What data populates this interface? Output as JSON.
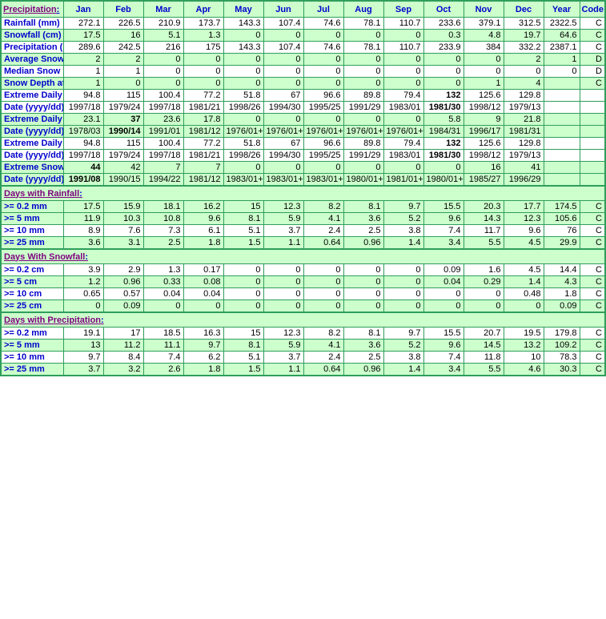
{
  "table": {
    "title": "Precipitation",
    "title_colon": ":",
    "columns": [
      "Jan",
      "Feb",
      "Mar",
      "Apr",
      "May",
      "Jun",
      "Jul",
      "Aug",
      "Sep",
      "Oct",
      "Nov",
      "Dec",
      "Year",
      "Code"
    ],
    "sections": [
      {
        "banner": null,
        "rows": [
          {
            "label": "Rainfall (mm)",
            "shade": false,
            "values": [
              "272.1",
              "226.5",
              "210.9",
              "173.7",
              "143.3",
              "107.4",
              "74.6",
              "78.1",
              "110.7",
              "233.6",
              "379.1",
              "312.5",
              "2322.5",
              "C"
            ],
            "bold": []
          },
          {
            "label": "Snowfall (cm)",
            "shade": true,
            "values": [
              "17.5",
              "16",
              "5.1",
              "1.3",
              "0",
              "0",
              "0",
              "0",
              "0",
              "0.3",
              "4.8",
              "19.7",
              "64.6",
              "C"
            ],
            "bold": []
          },
          {
            "label": "Precipitation (mm)",
            "shade": false,
            "values": [
              "289.6",
              "242.5",
              "216",
              "175",
              "143.3",
              "107.4",
              "74.6",
              "78.1",
              "110.7",
              "233.9",
              "384",
              "332.2",
              "2387.1",
              "C"
            ],
            "bold": []
          },
          {
            "label": "Average Snow Depth (cm)",
            "shade": true,
            "values": [
              "2",
              "2",
              "0",
              "0",
              "0",
              "0",
              "0",
              "0",
              "0",
              "0",
              "0",
              "2",
              "1",
              "D"
            ],
            "bold": []
          },
          {
            "label": "Median Snow Depth (cm)",
            "shade": false,
            "values": [
              "1",
              "1",
              "0",
              "0",
              "0",
              "0",
              "0",
              "0",
              "0",
              "0",
              "0",
              "0",
              "0",
              "D"
            ],
            "bold": []
          },
          {
            "label": "Snow Depth at Month-end (cm)",
            "shade": true,
            "values": [
              "1",
              "0",
              "0",
              "0",
              "0",
              "0",
              "0",
              "0",
              "0",
              "0",
              "1",
              "4",
              "",
              "C"
            ],
            "bold": []
          },
          {
            "label": "Extreme Daily Rainfall (mm)",
            "shade": false,
            "values": [
              "94.8",
              "115",
              "100.4",
              "77.2",
              "51.8",
              "67",
              "96.6",
              "89.8",
              "79.4",
              "132",
              "125.6",
              "129.8",
              "",
              ""
            ],
            "bold": [
              9
            ]
          },
          {
            "label": "Date (yyyy/dd)",
            "shade": false,
            "values": [
              "1997/18",
              "1979/24",
              "1997/18",
              "1981/21",
              "1998/26",
              "1994/30",
              "1995/25",
              "1991/29",
              "1983/01",
              "1981/30",
              "1998/12",
              "1979/13",
              "",
              ""
            ],
            "bold": [
              9
            ]
          },
          {
            "label": "Extreme Daily Snowfall (cm)",
            "shade": true,
            "values": [
              "23.1",
              "37",
              "23.6",
              "17.8",
              "0",
              "0",
              "0",
              "0",
              "0",
              "5.8",
              "9",
              "21.8",
              "",
              ""
            ],
            "bold": [
              1
            ]
          },
          {
            "label": "Date (yyyy/dd)",
            "shade": true,
            "values": [
              "1978/03",
              "1990/14",
              "1991/01",
              "1981/12",
              "1976/01+",
              "1976/01+",
              "1976/01+",
              "1976/01+",
              "1976/01+",
              "1984/31",
              "1996/17",
              "1981/31",
              "",
              ""
            ],
            "bold": [
              1
            ]
          },
          {
            "label": "Extreme Daily Precipitation (mm)",
            "shade": false,
            "values": [
              "94.8",
              "115",
              "100.4",
              "77.2",
              "51.8",
              "67",
              "96.6",
              "89.8",
              "79.4",
              "132",
              "125.6",
              "129.8",
              "",
              ""
            ],
            "bold": [
              9
            ]
          },
          {
            "label": "Date (yyyy/dd)",
            "shade": false,
            "values": [
              "1997/18",
              "1979/24",
              "1997/18",
              "1981/21",
              "1998/26",
              "1994/30",
              "1995/25",
              "1991/29",
              "1983/01",
              "1981/30",
              "1998/12",
              "1979/13",
              "",
              ""
            ],
            "bold": [
              9
            ]
          },
          {
            "label": "Extreme Snow Depth (cm)",
            "shade": true,
            "values": [
              "44",
              "42",
              "7",
              "7",
              "0",
              "0",
              "0",
              "0",
              "0",
              "0",
              "16",
              "41",
              "",
              ""
            ],
            "bold": [
              0
            ]
          },
          {
            "label": "Date (yyyy/dd)",
            "shade": true,
            "values": [
              "1991/08",
              "1990/15",
              "1994/22",
              "1981/12",
              "1983/01+",
              "1983/01+",
              "1983/01+",
              "1980/01+",
              "1981/01+",
              "1980/01+",
              "1985/27",
              "1996/29",
              "",
              ""
            ],
            "bold": [
              0
            ]
          }
        ]
      },
      {
        "banner": "Days with Rainfall",
        "banner_colon": ":",
        "rows": [
          {
            "label": ">= 0.2 mm",
            "shade": true,
            "values": [
              "17.5",
              "15.9",
              "18.1",
              "16.2",
              "15",
              "12.3",
              "8.2",
              "8.1",
              "9.7",
              "15.5",
              "20.3",
              "17.7",
              "174.5",
              "C"
            ],
            "bold": []
          },
          {
            "label": ">= 5 mm",
            "shade": true,
            "values": [
              "11.9",
              "10.3",
              "10.8",
              "9.6",
              "8.1",
              "5.9",
              "4.1",
              "3.6",
              "5.2",
              "9.6",
              "14.3",
              "12.3",
              "105.6",
              "C"
            ],
            "bold": []
          },
          {
            "label": ">= 10 mm",
            "shade": false,
            "values": [
              "8.9",
              "7.6",
              "7.3",
              "6.1",
              "5.1",
              "3.7",
              "2.4",
              "2.5",
              "3.8",
              "7.4",
              "11.7",
              "9.6",
              "76",
              "C"
            ],
            "bold": []
          },
          {
            "label": ">= 25 mm",
            "shade": true,
            "values": [
              "3.6",
              "3.1",
              "2.5",
              "1.8",
              "1.5",
              "1.1",
              "0.64",
              "0.96",
              "1.4",
              "3.4",
              "5.5",
              "4.5",
              "29.9",
              "C"
            ],
            "bold": []
          }
        ]
      },
      {
        "banner": "Days With Snowfall",
        "banner_colon": ":",
        "rows": [
          {
            "label": ">= 0.2 cm",
            "shade": false,
            "values": [
              "3.9",
              "2.9",
              "1.3",
              "0.17",
              "0",
              "0",
              "0",
              "0",
              "0",
              "0.09",
              "1.6",
              "4.5",
              "14.4",
              "C"
            ],
            "bold": []
          },
          {
            "label": ">= 5 cm",
            "shade": true,
            "values": [
              "1.2",
              "0.96",
              "0.33",
              "0.08",
              "0",
              "0",
              "0",
              "0",
              "0",
              "0.04",
              "0.29",
              "1.4",
              "4.3",
              "C"
            ],
            "bold": []
          },
          {
            "label": ">= 10 cm",
            "shade": false,
            "values": [
              "0.65",
              "0.57",
              "0.04",
              "0.04",
              "0",
              "0",
              "0",
              "0",
              "0",
              "0",
              "0",
              "0.48",
              "1.8",
              "C"
            ],
            "bold": []
          },
          {
            "label": ">= 25 cm",
            "shade": true,
            "values": [
              "0",
              "0.09",
              "0",
              "0",
              "0",
              "0",
              "0",
              "0",
              "0",
              "0",
              "0",
              "0",
              "0.09",
              "C"
            ],
            "bold": []
          }
        ]
      },
      {
        "banner": "Days with Precipitation",
        "banner_colon": ":",
        "rows": [
          {
            "label": ">= 0.2 mm",
            "shade": false,
            "values": [
              "19.1",
              "17",
              "18.5",
              "16.3",
              "15",
              "12.3",
              "8.2",
              "8.1",
              "9.7",
              "15.5",
              "20.7",
              "19.5",
              "179.8",
              "C"
            ],
            "bold": []
          },
          {
            "label": ">= 5 mm",
            "shade": true,
            "values": [
              "13",
              "11.2",
              "11.1",
              "9.7",
              "8.1",
              "5.9",
              "4.1",
              "3.6",
              "5.2",
              "9.6",
              "14.5",
              "13.2",
              "109.2",
              "C"
            ],
            "bold": []
          },
          {
            "label": ">= 10 mm",
            "shade": false,
            "values": [
              "9.7",
              "8.4",
              "7.4",
              "6.2",
              "5.1",
              "3.7",
              "2.4",
              "2.5",
              "3.8",
              "7.4",
              "11.8",
              "10",
              "78.3",
              "C"
            ],
            "bold": []
          },
          {
            "label": ">= 25 mm",
            "shade": true,
            "values": [
              "3.7",
              "3.2",
              "2.6",
              "1.8",
              "1.5",
              "1.1",
              "0.64",
              "0.96",
              "1.4",
              "3.4",
              "5.5",
              "4.6",
              "30.3",
              "C"
            ],
            "bold": []
          }
        ]
      }
    ]
  },
  "colors": {
    "grid": "#2e9e5b",
    "shade": "#ccffcc",
    "label_text": "#0000cc",
    "banner_text": "#800080",
    "value_text": "#000000"
  }
}
